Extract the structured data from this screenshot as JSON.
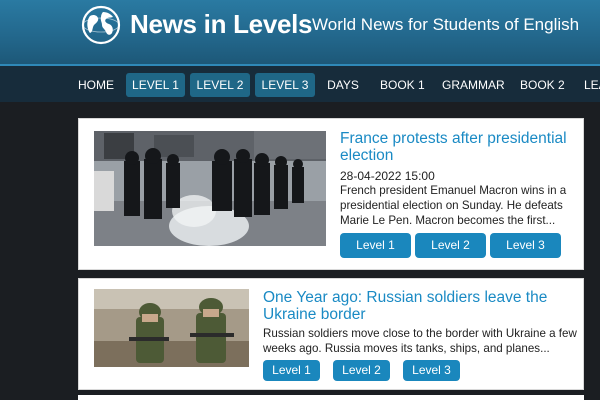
{
  "header": {
    "logo_text": "News in Levels",
    "tagline": "World News for Students of English"
  },
  "nav": {
    "items": [
      {
        "label": "HOME"
      },
      {
        "label": "LEVEL 1"
      },
      {
        "label": "LEVEL 2"
      },
      {
        "label": "LEVEL 3"
      },
      {
        "label": "DAYS"
      },
      {
        "label": "BOOK 1"
      },
      {
        "label": "GRAMMAR"
      },
      {
        "label": "BOOK 2"
      },
      {
        "label": "LEA"
      }
    ]
  },
  "articles": [
    {
      "title": "France protests after presidential election",
      "date": "28-04-2022 15:00",
      "excerpt": "French president Emanuel Macron wins in a presidential election on Sunday. He defeats Marie Le Pen. Macron becomes the first...",
      "levels": [
        "Level 1",
        "Level 2",
        "Level 3"
      ]
    },
    {
      "title": "One Year ago: Russian soldiers leave the Ukraine border",
      "excerpt": "Russian soldiers move close to the border with Ukraine a few weeks ago. Russia moves its tanks, ships, and planes...",
      "levels": [
        "Level 1",
        "Level 2",
        "Level 3"
      ]
    }
  ]
}
